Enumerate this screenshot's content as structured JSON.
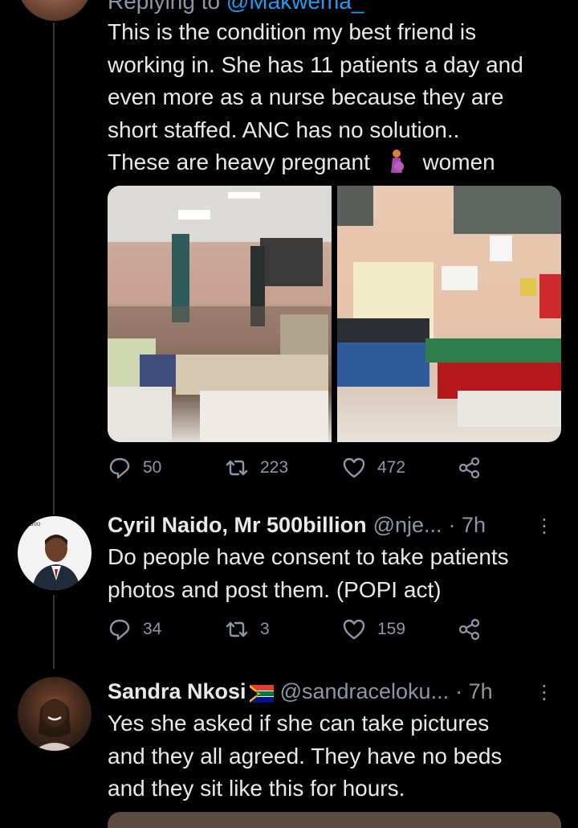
{
  "tweet1": {
    "replying_prefix": "Replying to",
    "replying_handle": "@Makwema_",
    "lines": [
      "This is the condition my best friend is",
      "working in. She has 11 patients a day and",
      "even more as a nurse because they are",
      "short staffed. ANC has no solution..",
      "These are heavy pregnant",
      "women"
    ],
    "stats": {
      "replies": "50",
      "retweets": "223",
      "likes": "472"
    }
  },
  "tweet2": {
    "name": "Cyril Naido, Mr 500billion",
    "handle": "@nje...",
    "time": "· 7h",
    "avatar_label": "Naidoo",
    "lines": [
      "Do people have consent to take patients",
      "photos and post them. (POPI act)"
    ],
    "stats": {
      "replies": "34",
      "retweets": "3",
      "likes": "159"
    }
  },
  "tweet3": {
    "name": "Sandra Nkosi",
    "handle": "@sandraceloku...",
    "time": "· 7h",
    "lines": [
      "Yes she asked if she can take pictures",
      "and they all agreed. They have no beds",
      "and they sit like this for hours."
    ]
  },
  "colors": {
    "background": "#000000",
    "text": "#e7e9ea",
    "muted": "#8b98a5",
    "link": "#1d9bf0"
  }
}
